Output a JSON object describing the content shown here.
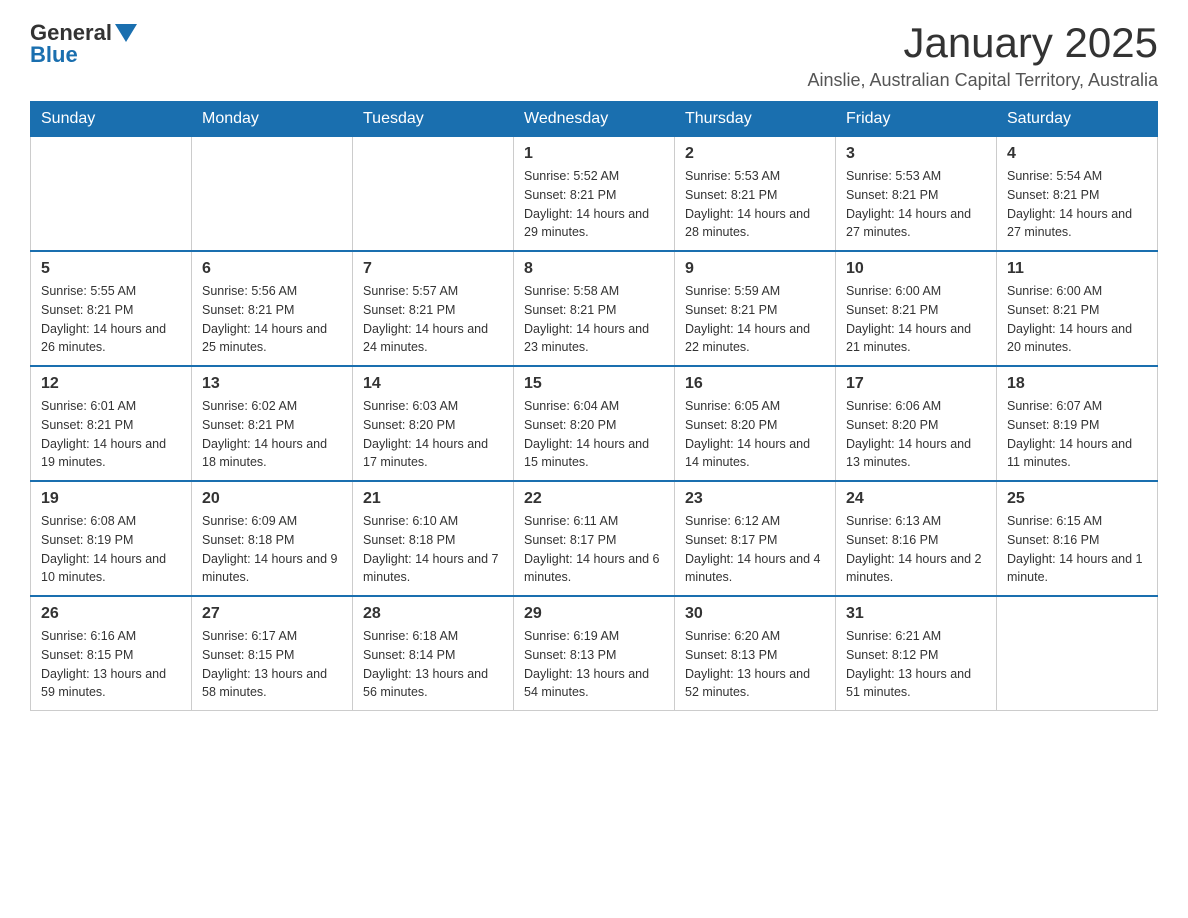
{
  "logo": {
    "general": "General",
    "blue": "Blue"
  },
  "title": "January 2025",
  "subtitle": "Ainslie, Australian Capital Territory, Australia",
  "headers": [
    "Sunday",
    "Monday",
    "Tuesday",
    "Wednesday",
    "Thursday",
    "Friday",
    "Saturday"
  ],
  "weeks": [
    [
      {
        "day": "",
        "sunrise": "",
        "sunset": "",
        "daylight": ""
      },
      {
        "day": "",
        "sunrise": "",
        "sunset": "",
        "daylight": ""
      },
      {
        "day": "",
        "sunrise": "",
        "sunset": "",
        "daylight": ""
      },
      {
        "day": "1",
        "sunrise": "Sunrise: 5:52 AM",
        "sunset": "Sunset: 8:21 PM",
        "daylight": "Daylight: 14 hours and 29 minutes."
      },
      {
        "day": "2",
        "sunrise": "Sunrise: 5:53 AM",
        "sunset": "Sunset: 8:21 PM",
        "daylight": "Daylight: 14 hours and 28 minutes."
      },
      {
        "day": "3",
        "sunrise": "Sunrise: 5:53 AM",
        "sunset": "Sunset: 8:21 PM",
        "daylight": "Daylight: 14 hours and 27 minutes."
      },
      {
        "day": "4",
        "sunrise": "Sunrise: 5:54 AM",
        "sunset": "Sunset: 8:21 PM",
        "daylight": "Daylight: 14 hours and 27 minutes."
      }
    ],
    [
      {
        "day": "5",
        "sunrise": "Sunrise: 5:55 AM",
        "sunset": "Sunset: 8:21 PM",
        "daylight": "Daylight: 14 hours and 26 minutes."
      },
      {
        "day": "6",
        "sunrise": "Sunrise: 5:56 AM",
        "sunset": "Sunset: 8:21 PM",
        "daylight": "Daylight: 14 hours and 25 minutes."
      },
      {
        "day": "7",
        "sunrise": "Sunrise: 5:57 AM",
        "sunset": "Sunset: 8:21 PM",
        "daylight": "Daylight: 14 hours and 24 minutes."
      },
      {
        "day": "8",
        "sunrise": "Sunrise: 5:58 AM",
        "sunset": "Sunset: 8:21 PM",
        "daylight": "Daylight: 14 hours and 23 minutes."
      },
      {
        "day": "9",
        "sunrise": "Sunrise: 5:59 AM",
        "sunset": "Sunset: 8:21 PM",
        "daylight": "Daylight: 14 hours and 22 minutes."
      },
      {
        "day": "10",
        "sunrise": "Sunrise: 6:00 AM",
        "sunset": "Sunset: 8:21 PM",
        "daylight": "Daylight: 14 hours and 21 minutes."
      },
      {
        "day": "11",
        "sunrise": "Sunrise: 6:00 AM",
        "sunset": "Sunset: 8:21 PM",
        "daylight": "Daylight: 14 hours and 20 minutes."
      }
    ],
    [
      {
        "day": "12",
        "sunrise": "Sunrise: 6:01 AM",
        "sunset": "Sunset: 8:21 PM",
        "daylight": "Daylight: 14 hours and 19 minutes."
      },
      {
        "day": "13",
        "sunrise": "Sunrise: 6:02 AM",
        "sunset": "Sunset: 8:21 PM",
        "daylight": "Daylight: 14 hours and 18 minutes."
      },
      {
        "day": "14",
        "sunrise": "Sunrise: 6:03 AM",
        "sunset": "Sunset: 8:20 PM",
        "daylight": "Daylight: 14 hours and 17 minutes."
      },
      {
        "day": "15",
        "sunrise": "Sunrise: 6:04 AM",
        "sunset": "Sunset: 8:20 PM",
        "daylight": "Daylight: 14 hours and 15 minutes."
      },
      {
        "day": "16",
        "sunrise": "Sunrise: 6:05 AM",
        "sunset": "Sunset: 8:20 PM",
        "daylight": "Daylight: 14 hours and 14 minutes."
      },
      {
        "day": "17",
        "sunrise": "Sunrise: 6:06 AM",
        "sunset": "Sunset: 8:20 PM",
        "daylight": "Daylight: 14 hours and 13 minutes."
      },
      {
        "day": "18",
        "sunrise": "Sunrise: 6:07 AM",
        "sunset": "Sunset: 8:19 PM",
        "daylight": "Daylight: 14 hours and 11 minutes."
      }
    ],
    [
      {
        "day": "19",
        "sunrise": "Sunrise: 6:08 AM",
        "sunset": "Sunset: 8:19 PM",
        "daylight": "Daylight: 14 hours and 10 minutes."
      },
      {
        "day": "20",
        "sunrise": "Sunrise: 6:09 AM",
        "sunset": "Sunset: 8:18 PM",
        "daylight": "Daylight: 14 hours and 9 minutes."
      },
      {
        "day": "21",
        "sunrise": "Sunrise: 6:10 AM",
        "sunset": "Sunset: 8:18 PM",
        "daylight": "Daylight: 14 hours and 7 minutes."
      },
      {
        "day": "22",
        "sunrise": "Sunrise: 6:11 AM",
        "sunset": "Sunset: 8:17 PM",
        "daylight": "Daylight: 14 hours and 6 minutes."
      },
      {
        "day": "23",
        "sunrise": "Sunrise: 6:12 AM",
        "sunset": "Sunset: 8:17 PM",
        "daylight": "Daylight: 14 hours and 4 minutes."
      },
      {
        "day": "24",
        "sunrise": "Sunrise: 6:13 AM",
        "sunset": "Sunset: 8:16 PM",
        "daylight": "Daylight: 14 hours and 2 minutes."
      },
      {
        "day": "25",
        "sunrise": "Sunrise: 6:15 AM",
        "sunset": "Sunset: 8:16 PM",
        "daylight": "Daylight: 14 hours and 1 minute."
      }
    ],
    [
      {
        "day": "26",
        "sunrise": "Sunrise: 6:16 AM",
        "sunset": "Sunset: 8:15 PM",
        "daylight": "Daylight: 13 hours and 59 minutes."
      },
      {
        "day": "27",
        "sunrise": "Sunrise: 6:17 AM",
        "sunset": "Sunset: 8:15 PM",
        "daylight": "Daylight: 13 hours and 58 minutes."
      },
      {
        "day": "28",
        "sunrise": "Sunrise: 6:18 AM",
        "sunset": "Sunset: 8:14 PM",
        "daylight": "Daylight: 13 hours and 56 minutes."
      },
      {
        "day": "29",
        "sunrise": "Sunrise: 6:19 AM",
        "sunset": "Sunset: 8:13 PM",
        "daylight": "Daylight: 13 hours and 54 minutes."
      },
      {
        "day": "30",
        "sunrise": "Sunrise: 6:20 AM",
        "sunset": "Sunset: 8:13 PM",
        "daylight": "Daylight: 13 hours and 52 minutes."
      },
      {
        "day": "31",
        "sunrise": "Sunrise: 6:21 AM",
        "sunset": "Sunset: 8:12 PM",
        "daylight": "Daylight: 13 hours and 51 minutes."
      },
      {
        "day": "",
        "sunrise": "",
        "sunset": "",
        "daylight": ""
      }
    ]
  ]
}
